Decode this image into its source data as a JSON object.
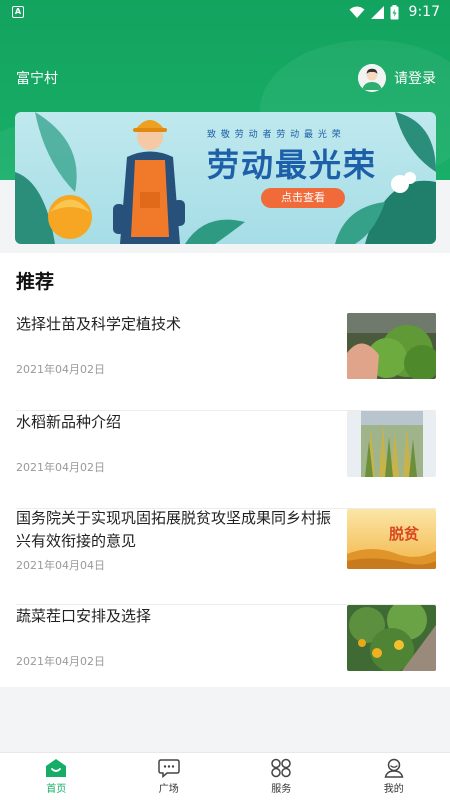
{
  "status_bar": {
    "left_badge": "A",
    "time": "9:17"
  },
  "header": {
    "village": "富宁村",
    "login_label": "请登录"
  },
  "banner": {
    "small_text": "致 敬 劳 动 者   劳 动 最 光 荣",
    "headline": "劳动最光荣",
    "button_label": "点击查看"
  },
  "section": {
    "title": "推荐"
  },
  "news": [
    {
      "title": "选择壮苗及科学定植技术",
      "date": "2021年04月02日",
      "thumb": "seedlings-photo"
    },
    {
      "title": "水稻新品种介绍",
      "date": "2021年04月02日",
      "thumb": "rice-field-photo"
    },
    {
      "title": "国务院关于实现巩固拓展脱贫攻坚成果同乡村振兴有效衔接的意见",
      "date": "2021年04月04日",
      "thumb": "poverty-relief-banner"
    },
    {
      "title": "蔬菜茬口安排及选择",
      "date": "2021年04月02日",
      "thumb": "greenhouse-peppers-photo"
    }
  ],
  "thumb_texts": {
    "poverty_relief": "脱贫"
  },
  "bottom_nav": [
    {
      "label": "首页",
      "icon": "home-icon",
      "active": true
    },
    {
      "label": "广场",
      "icon": "chat-bubble-icon",
      "active": false
    },
    {
      "label": "服务",
      "icon": "grid-icon",
      "active": false
    },
    {
      "label": "我的",
      "icon": "user-icon",
      "active": false
    }
  ],
  "colors": {
    "primary_green": "#17ad67",
    "banner_button": "#f06a3a",
    "headline": "#1d5fa8"
  }
}
